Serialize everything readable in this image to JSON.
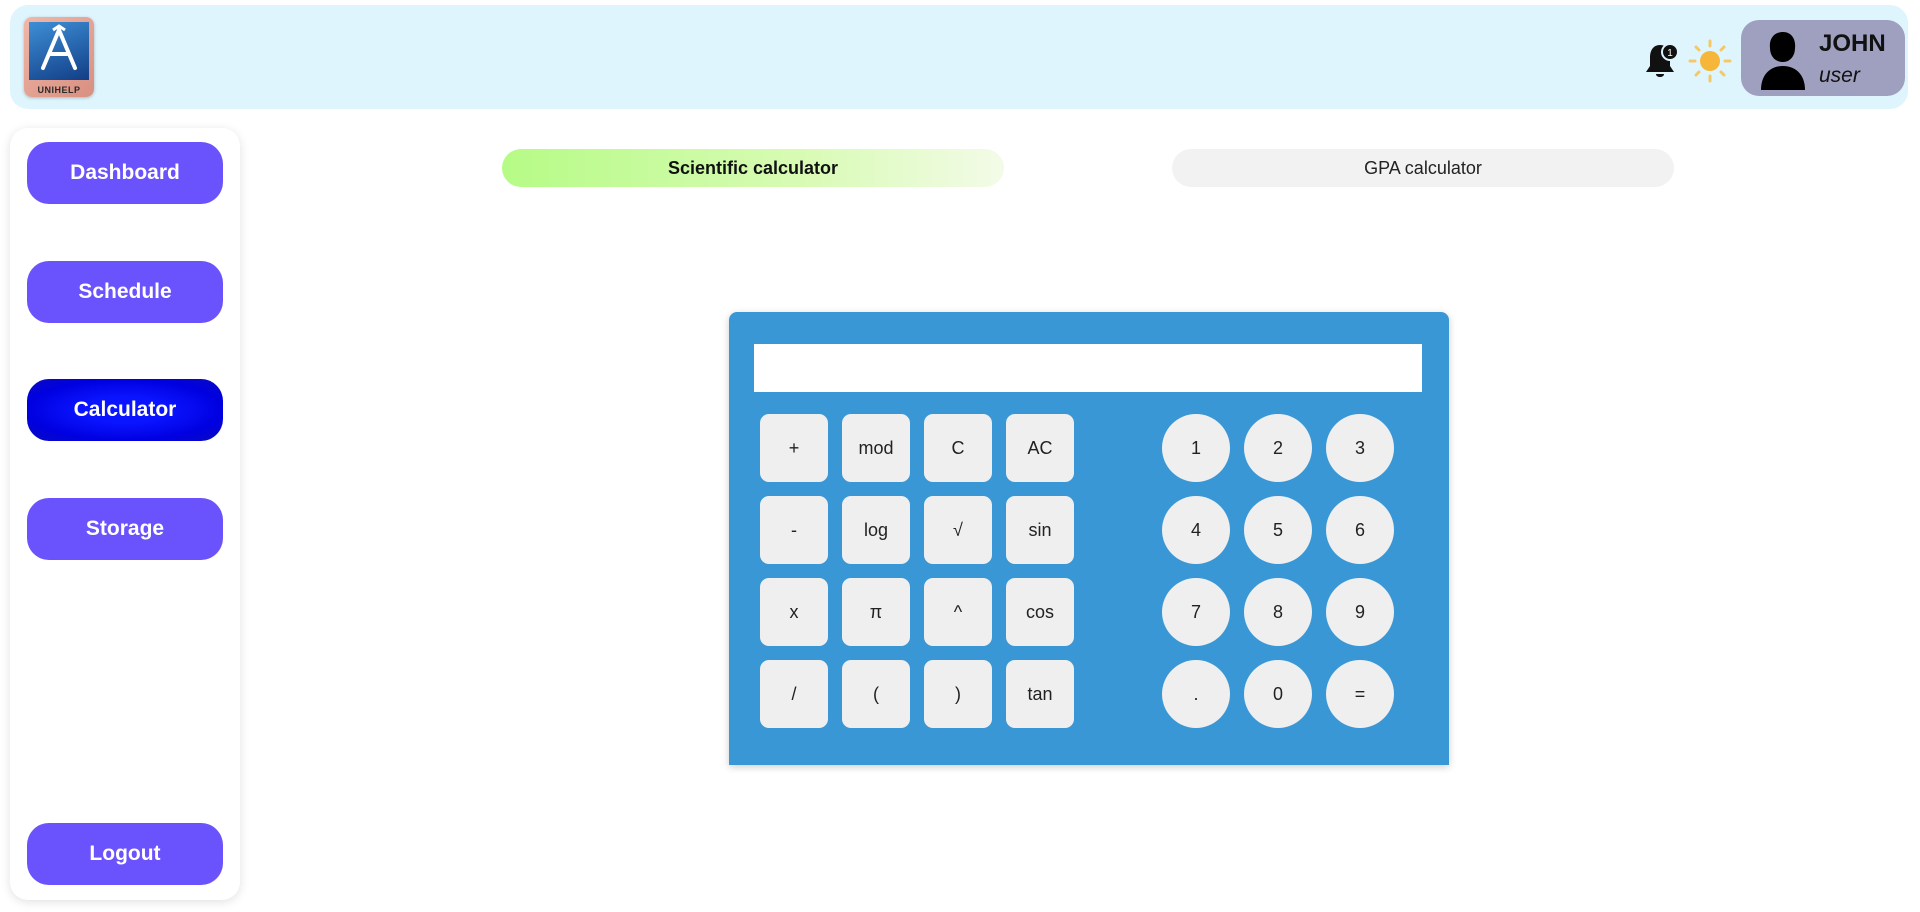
{
  "header": {
    "logo_text": "UNIHELP",
    "notification_count": "1",
    "user": {
      "name": "JOHN",
      "role": "user"
    }
  },
  "sidebar": {
    "items": [
      {
        "label": "Dashboard"
      },
      {
        "label": "Schedule"
      },
      {
        "label": "Calculator"
      },
      {
        "label": "Storage"
      }
    ],
    "logout_label": "Logout"
  },
  "tabs": [
    {
      "label": "Scientific calculator"
    },
    {
      "label": "GPA calculator"
    }
  ],
  "calculator": {
    "display_value": "",
    "function_keys": [
      [
        "+",
        "mod",
        "C",
        "AC"
      ],
      [
        "-",
        "log",
        "√",
        "sin"
      ],
      [
        "x",
        "π",
        "^",
        "cos"
      ],
      [
        "/",
        "(",
        ")",
        "tan"
      ]
    ],
    "number_keys": [
      [
        "1",
        "2",
        "3"
      ],
      [
        "4",
        "5",
        "6"
      ],
      [
        "7",
        "8",
        "9"
      ],
      [
        ".",
        "0",
        "="
      ]
    ]
  },
  "colors": {
    "header_bg": "#dff5fd",
    "nav_button": "#6a53fc",
    "nav_active": "#0000e0",
    "calculator_body": "#3a97d6",
    "key_bg": "#efefef",
    "user_card": "#9f9fbf",
    "tab_active": "#b6fb86"
  }
}
